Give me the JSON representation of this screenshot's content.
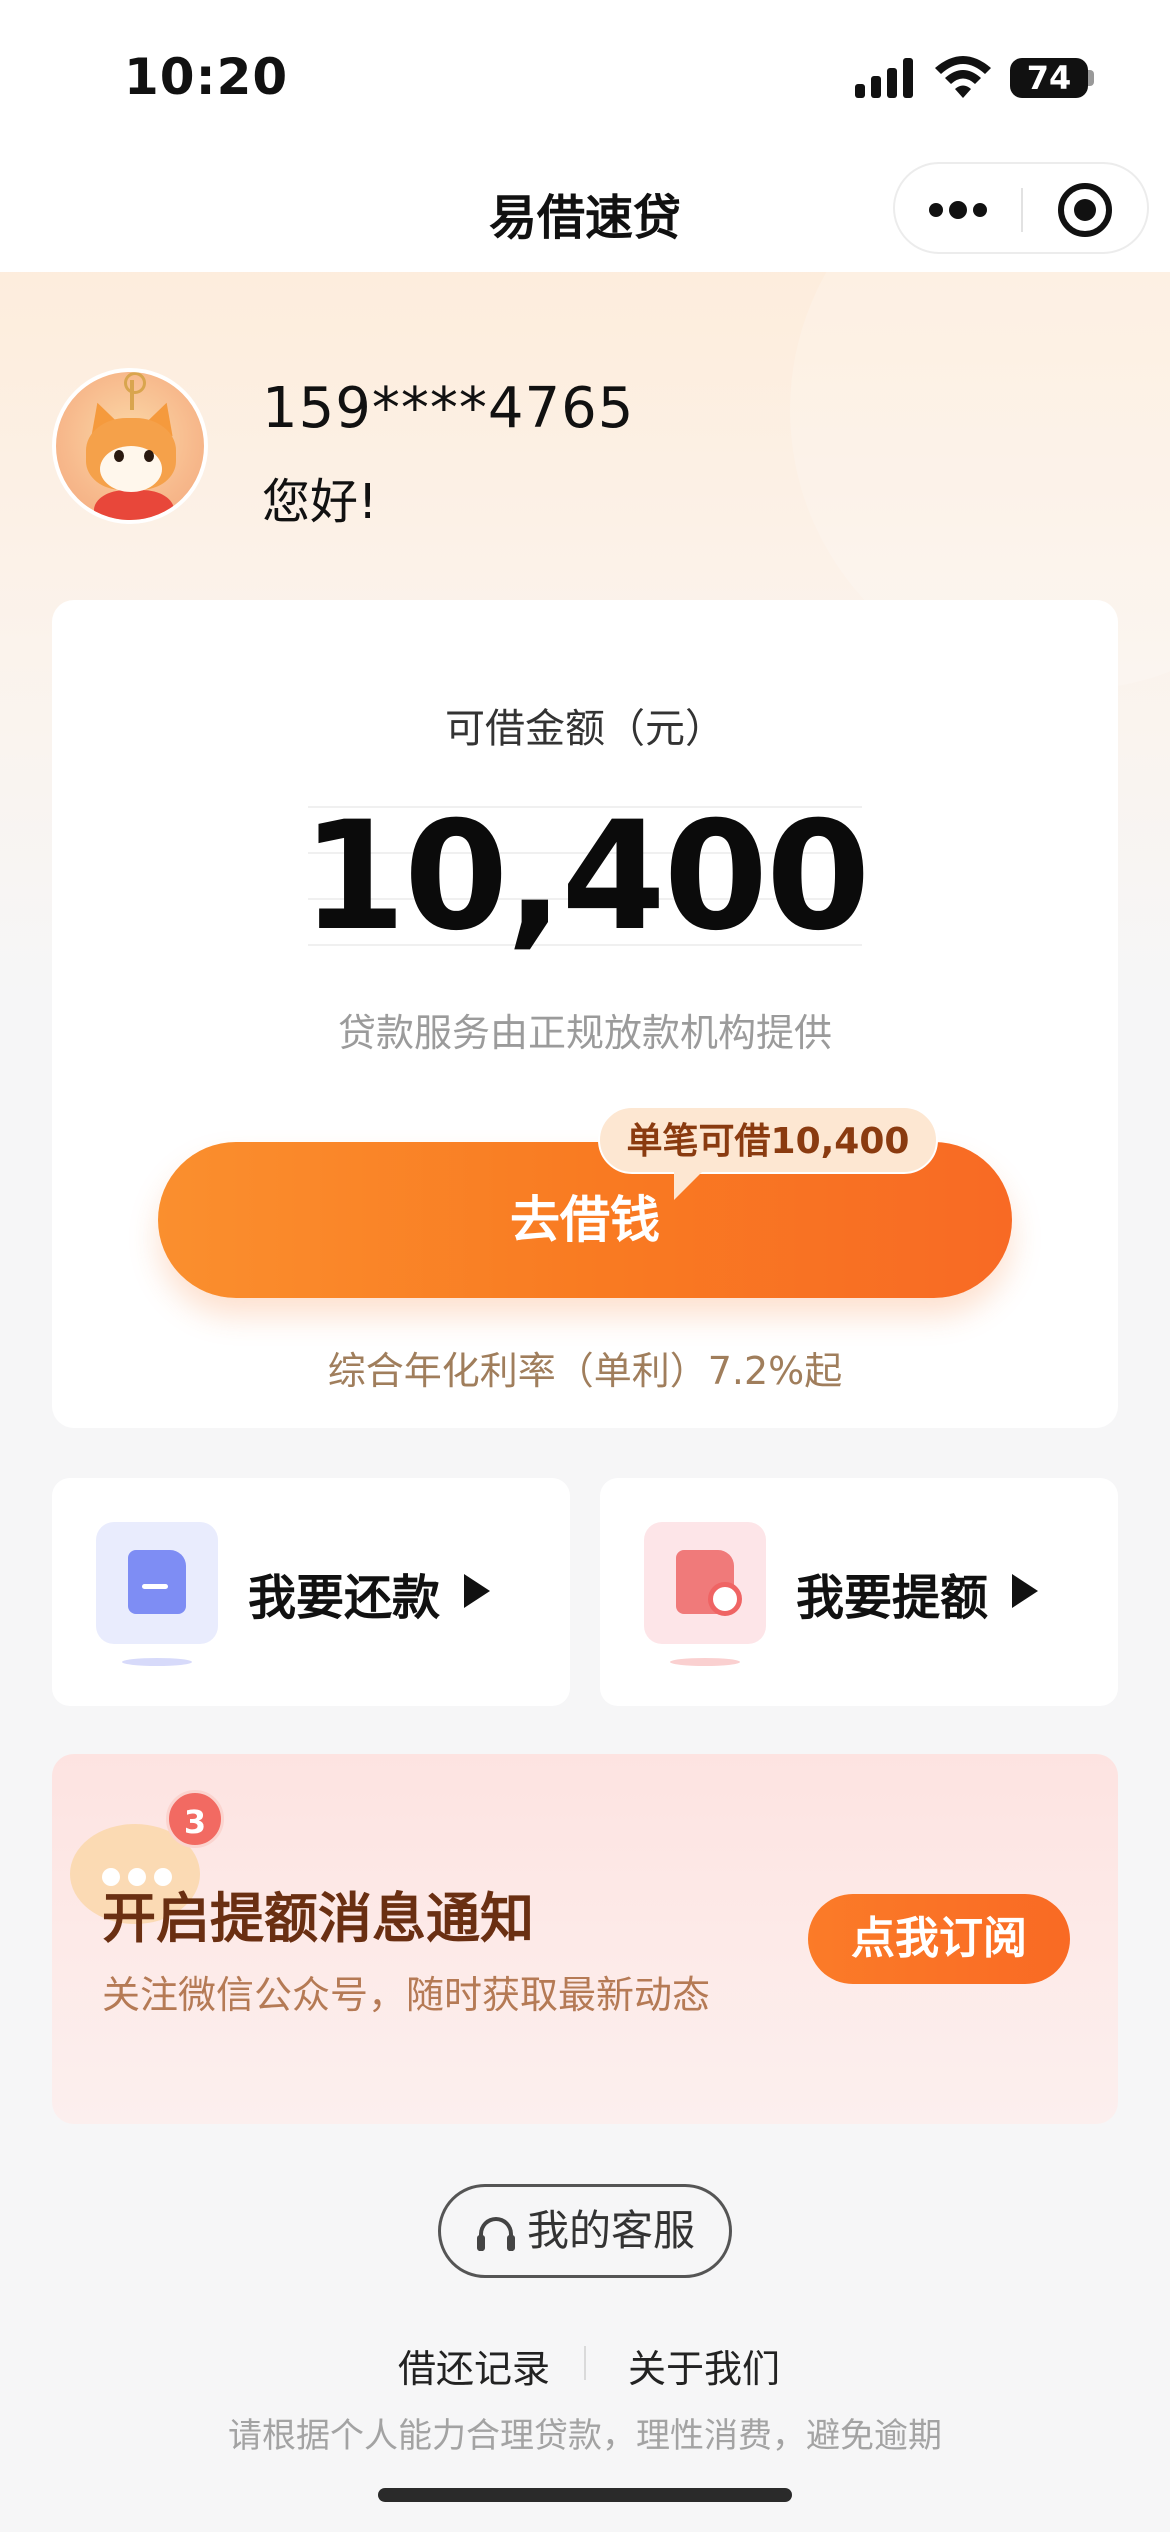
{
  "status_bar": {
    "time": "10:20",
    "battery": "74"
  },
  "nav": {
    "title": "易借速贷"
  },
  "user": {
    "phone": "159****4765",
    "greeting": "您好!"
  },
  "loan_card": {
    "amount_label": "可借金额（元）",
    "amount": "10,400",
    "provider_note": "贷款服务由正规放款机构提供",
    "borrow_button": "去借钱",
    "single_limit_tip": "单笔可借10,400",
    "rate_note": "综合年化利率（单利）7.2%起"
  },
  "actions": {
    "repay_label": "我要还款",
    "raise_label": "我要提额"
  },
  "notify": {
    "badge_count": "3",
    "title": "开启提额消息通知",
    "subtitle": "关注微信公众号，随时获取最新动态",
    "subscribe_button": "点我订阅"
  },
  "footer": {
    "service_button": "我的客服",
    "records_link": "借还记录",
    "about_link": "关于我们",
    "disclaimer": "请根据个人能力合理贷款，理性消费，避免逾期"
  },
  "colors": {
    "accent": "#f97b22",
    "tip_bg": "#fde7d2",
    "notify_title": "#6a2f12"
  }
}
